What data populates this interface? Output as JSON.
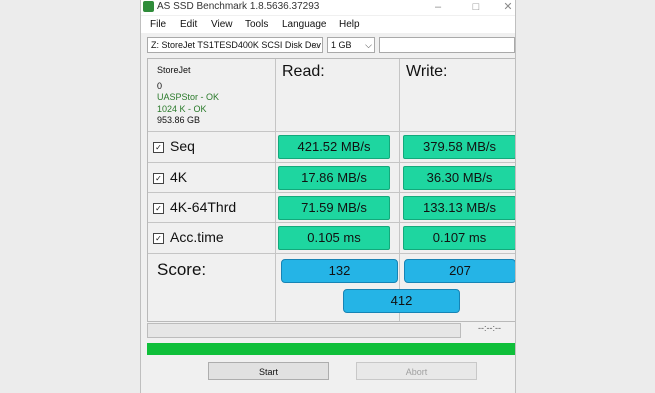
{
  "window": {
    "title": "AS SSD Benchmark 1.8.5636.37293",
    "app_icon": "as-ssd-app-icon",
    "minimize": "–",
    "maximize": "□",
    "close": "✕"
  },
  "menu": {
    "file": "File",
    "edit": "Edit",
    "view": "View",
    "tools": "Tools",
    "language": "Language",
    "help": "Help"
  },
  "toolbar": {
    "drive": "Z: StoreJet TS1TESD400K SCSI Disk Dev",
    "size": "1 GB",
    "path": ""
  },
  "info": {
    "name": "StoreJet",
    "line2": "0",
    "driver": "UASPStor - OK",
    "alignment": "1024 K - OK",
    "capacity": "953.86 GB"
  },
  "columns": {
    "read": "Read:",
    "write": "Write:"
  },
  "rows": [
    {
      "label": "Seq",
      "read": "421.52 MB/s",
      "write": "379.58 MB/s"
    },
    {
      "label": "4K",
      "read": "17.86 MB/s",
      "write": "36.30 MB/s"
    },
    {
      "label": "4K-64Thrd",
      "read": "71.59 MB/s",
      "write": "133.13 MB/s"
    },
    {
      "label": "Acc.time",
      "read": "0.105 ms",
      "write": "0.107 ms"
    }
  ],
  "score": {
    "label": "Score:",
    "read": "132",
    "write": "207",
    "total": "412"
  },
  "progress": {
    "time": "--:--:--",
    "bottom_fill_fraction": 1.0
  },
  "buttons": {
    "start": "Start",
    "abort": "Abort"
  },
  "colors": {
    "value_box": "#1ed6a0",
    "score_box": "#25b4e6",
    "progress_fill": "#0fbf3a",
    "ok_text": "#2a7a2a"
  }
}
